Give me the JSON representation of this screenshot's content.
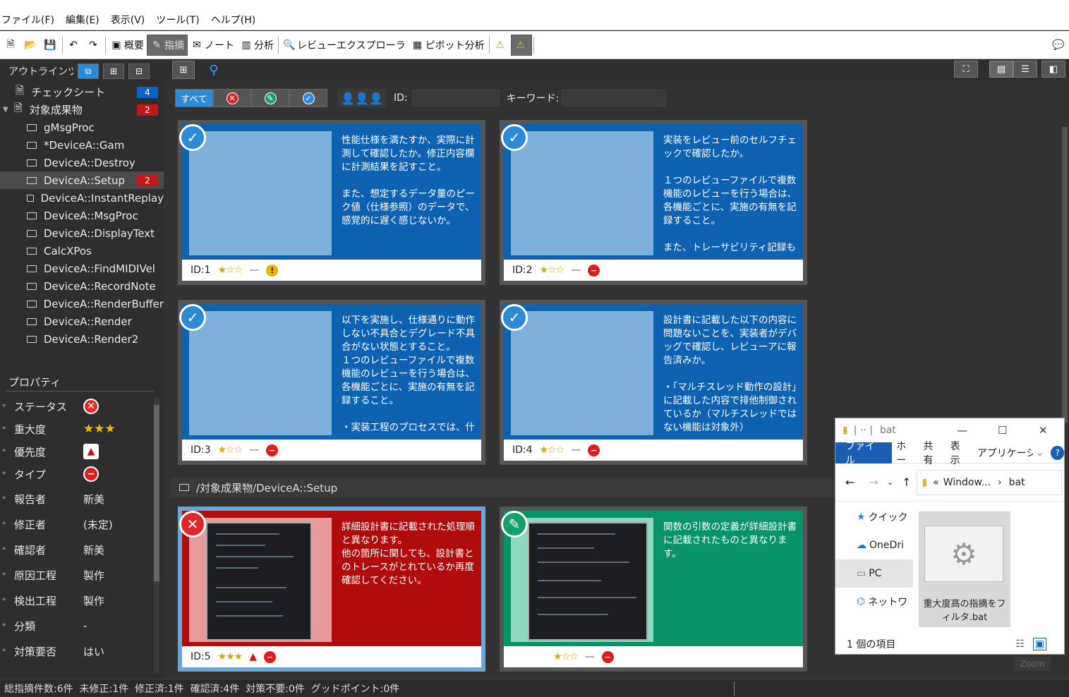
{
  "menu": [
    "ファイル(F)",
    "編集(E)",
    "表示(V)",
    "ツール(T)",
    "ヘルプ(H)"
  ],
  "toolbar": {
    "overview": "概要",
    "issue": "指摘",
    "note": "ノート",
    "analysis": "分析",
    "review_explorer": "レビューエクスプローラ",
    "pivot": "ピボット分析"
  },
  "outline": {
    "title": "アウトラインツリー",
    "checksheet": {
      "label": "チェックシート",
      "count": "4"
    },
    "artifact": {
      "label": "対象成果物",
      "count": "2"
    },
    "items": [
      {
        "label": "gMsgProc"
      },
      {
        "label": "*DeviceA::Gam"
      },
      {
        "label": "DeviceA::Destroy"
      },
      {
        "label": "DeviceA::Setup",
        "count": "2"
      },
      {
        "label": "DeviceA::InstantReplay"
      },
      {
        "label": "DeviceA::MsgProc"
      },
      {
        "label": "DeviceA::DisplayText"
      },
      {
        "label": "CalcXPos"
      },
      {
        "label": "DeviceA::FindMIDIVel"
      },
      {
        "label": "DeviceA::RecordNote"
      },
      {
        "label": "DeviceA::RenderBuffer"
      },
      {
        "label": "DeviceA::Render"
      },
      {
        "label": "DeviceA::Render2"
      }
    ]
  },
  "properties": {
    "title": "プロパティ",
    "rows": [
      {
        "key": "ステータス",
        "value": ""
      },
      {
        "key": "重大度",
        "value": "★★★"
      },
      {
        "key": "優先度",
        "value": ""
      },
      {
        "key": "タイプ",
        "value": ""
      },
      {
        "key": "報告者",
        "value": "新美"
      },
      {
        "key": "修正者",
        "value": "(未定)"
      },
      {
        "key": "確認者",
        "value": "新美"
      },
      {
        "key": "原因工程",
        "value": "製作"
      },
      {
        "key": "検出工程",
        "value": "製作"
      },
      {
        "key": "分類",
        "value": "-"
      },
      {
        "key": "対策要否",
        "value": "はい"
      }
    ]
  },
  "filter": {
    "all_label": "すべて",
    "id_label": "ID:",
    "keyword_label": "キーワード:"
  },
  "cards": [
    {
      "id": "ID:1",
      "stars": "★☆☆",
      "text": "性能仕様を満たすか、実際に計測して確認したか。修正内容欄に計測結果を記すこと。\n\nまた、想定するデータ量のピーク値（仕様参照）のデータで、感覚的に遅く感じないか。"
    },
    {
      "id": "ID:2",
      "stars": "★☆☆",
      "text": "実装をレビュー前のセルフチェックで確認したか。\n\n１つのレビューファイルで複数機能のレビューを行う場合は、各機能ごとに、実施の有無を記録すること。\n\nまた、トレーサビリティ記録も記"
    },
    {
      "id": "ID:3",
      "stars": "★☆☆",
      "text": "以下を実施し、仕様通りに動作しない不具合とデグレード不具合がない状態とすること。\n１つのレビューファイルで複数機能のレビューを行う場合は、各機能ごとに、実施の有無を記録すること。\n\n・実装工程のプロセスでは、什"
    },
    {
      "id": "ID:4",
      "stars": "★☆☆",
      "text": "設計書に記載した以下の内容に問題ないことを、実装者がデバッグで確認し、レビューアに報告済みか。\n\n・「マルチスレッド動作の設計」に記載した内容で排他制御されているか（マルチスレッドではない機能は対象外）"
    },
    {
      "id": "ID:5",
      "stars": "★★★",
      "text": "詳細設計書に記載された処理順と異なります。\n他の箇所に関しても、設計書とのトレースがとれているか再度確認してください。"
    },
    {
      "id": "",
      "stars": "★☆☆",
      "text": "関数の引数の定義が詳細設計書に記載されたものと異なります。"
    }
  ],
  "group_path": "/対象成果物/DeviceA::Setup",
  "status_bar": "総指摘件数:6件  未修正:1件  修正済:1件  確認済:4件  対策不要:0件  グッドポイント:0件",
  "explorer": {
    "title": "bat",
    "tabs": [
      "ファイル",
      "ホー",
      "共有",
      "表示",
      "アプリケーショ"
    ],
    "path1": "Window...",
    "path2": "bat",
    "nav": [
      "クイック",
      "OneDri",
      "PC",
      "ネットワ"
    ],
    "file_name": "重大度高の指摘をフィルタ.bat",
    "status": "1 個の項目"
  },
  "zoom_label": "Zoom",
  "colors": {
    "accent": "#2c8ad6",
    "card_blue": "#0e62b2",
    "card_red": "#b00c0c",
    "card_green": "#08936a"
  }
}
